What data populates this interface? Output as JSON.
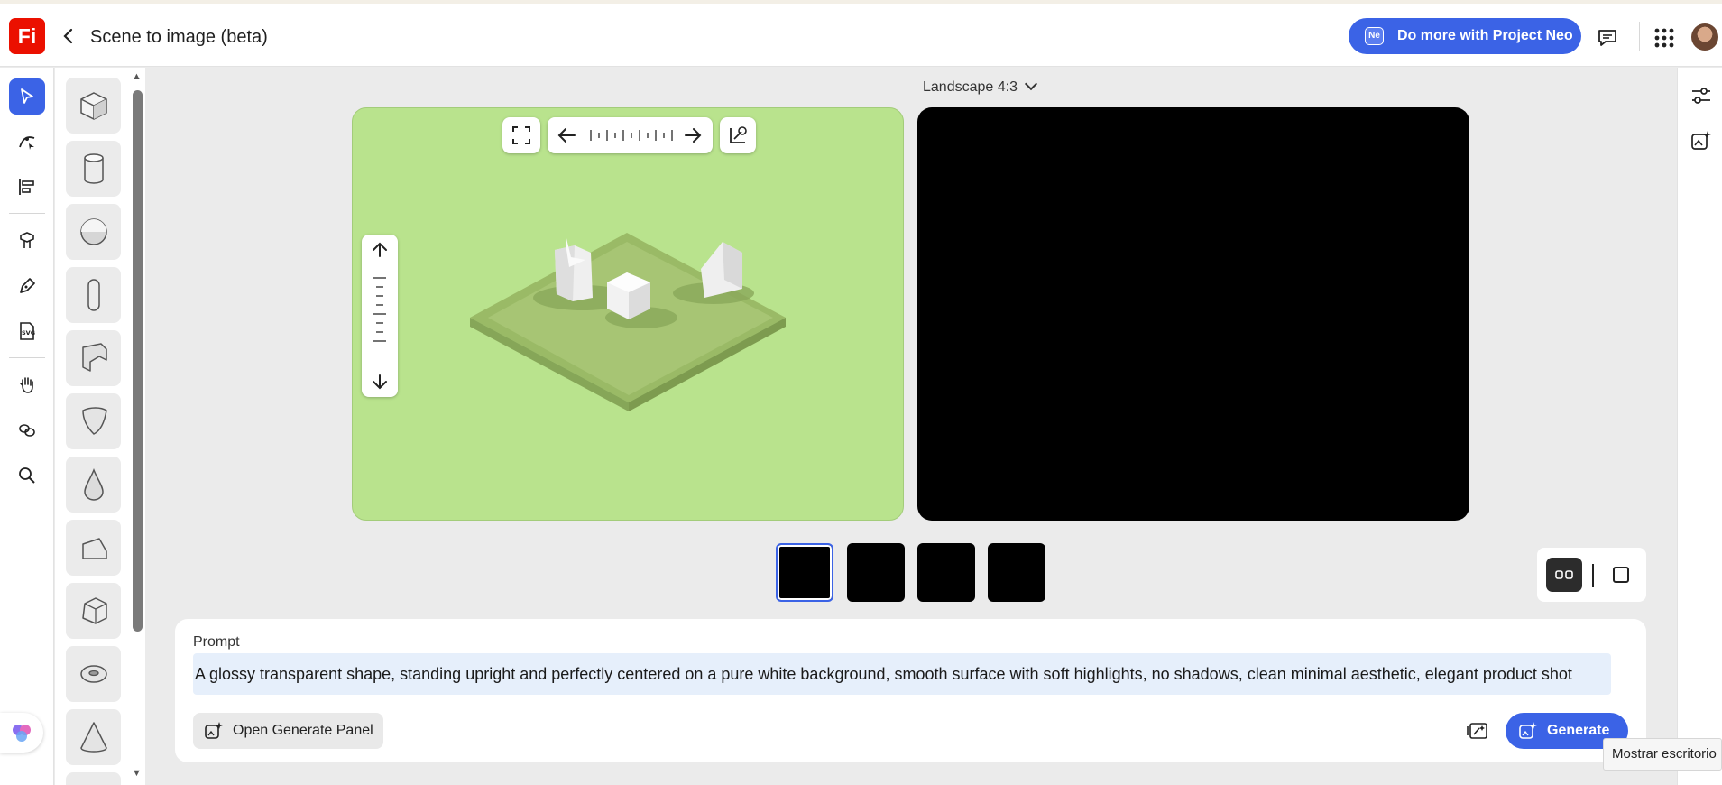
{
  "app": {
    "logo_text": "Fi",
    "title": "Scene to image (beta)"
  },
  "header": {
    "neo_button_label": "Do more with Project Neo",
    "neo_badge": "Ne",
    "icons": [
      "back-chevron-icon",
      "chat-icon",
      "apps-grid-icon",
      "avatar"
    ]
  },
  "left_tools": [
    "select-arrow-icon",
    "path-tool-icon",
    "align-icon",
    "shapes-library-icon",
    "pen-icon",
    "svg-icon",
    "hand-icon",
    "group-icon",
    "search-icon"
  ],
  "shapes_panel": [
    "cube",
    "cylinder",
    "sphere",
    "capsule",
    "flag",
    "blob",
    "drop",
    "wedge",
    "prism",
    "torus",
    "cone"
  ],
  "canvas": {
    "orientation_label": "Landscape 4:3",
    "scene_bg_color": "#b9e38d",
    "result_bg_color": "#000000"
  },
  "thumbnails": {
    "count": 4,
    "selected_index": 0
  },
  "prompt": {
    "label": "Prompt",
    "text": "A glossy transparent shape, standing upright and perfectly centered on a pure white background, smooth surface with soft highlights, no shadows, clean minimal aesthetic, elegant product shot",
    "open_panel_label": "Open Generate Panel",
    "generate_label": "Generate"
  },
  "tooltip": "Mostrar escritorio",
  "colors": {
    "accent": "#3b63e6",
    "brand_red": "#eb1000"
  }
}
